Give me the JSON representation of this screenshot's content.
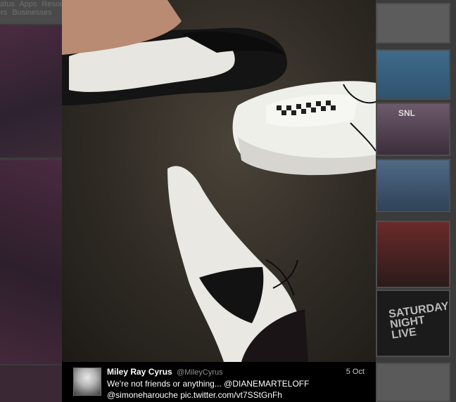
{
  "background": {
    "nav_row_1": [
      "tatus",
      "Apps",
      "Resou"
    ],
    "nav_row_2": [
      "ers",
      "Businesses"
    ],
    "thumb_snl_label": "SNL",
    "thumb_live_label": "SATURDAY NIGHT LIVE"
  },
  "tweet": {
    "display_name": "Miley Ray Cyrus",
    "handle": "@MileyCyrus",
    "date": "5 Oct",
    "text_part1": "We're not friends or anything... ",
    "mention_1": "@DIANEMARTELOFF",
    "mention_2": "@simoneharouche",
    "link": "pic.twitter.com/vt7SStGnFh"
  }
}
